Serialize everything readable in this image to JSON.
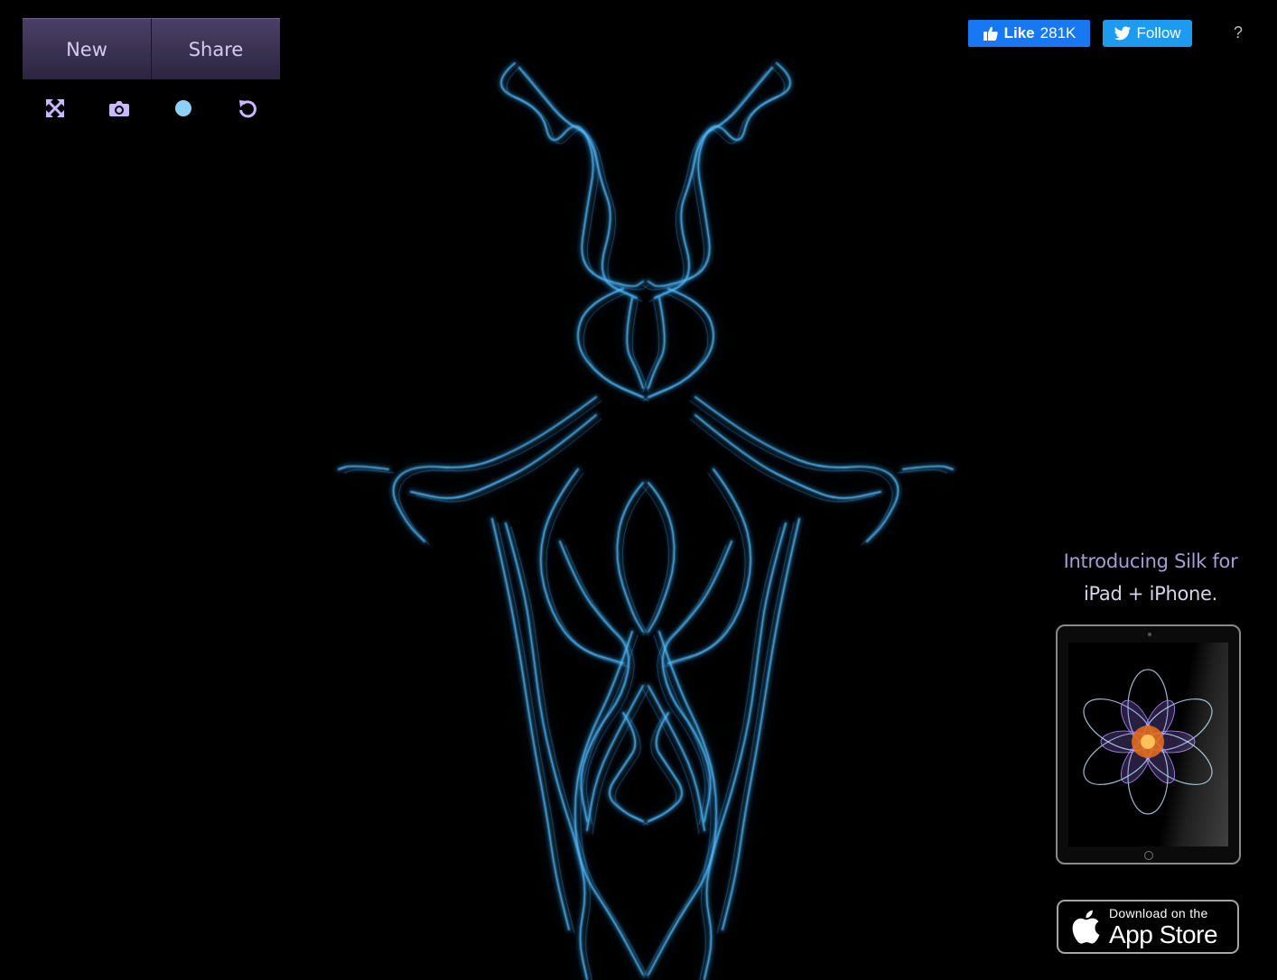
{
  "toolbar": {
    "new_label": "New",
    "share_label": "Share",
    "tools": [
      "fullscreen-icon",
      "camera-icon",
      "color-dot-icon",
      "undo-icon"
    ]
  },
  "social": {
    "like_label": "Like",
    "like_count": "281K",
    "follow_label": "Follow",
    "help_label": "?"
  },
  "promo": {
    "line1": "Introducing Silk for",
    "line2": "iPad + iPhone.",
    "store_small": "Download on the",
    "store_big": "App Store"
  },
  "colors": {
    "silk": "#5fc4ff",
    "panel_top": "#4a4066",
    "panel_bottom": "#2c2540",
    "tool_icon": "#c9b8ff",
    "color_dot": "#8fd0f6",
    "facebook": "#1877f2",
    "twitter": "#1d9bf0",
    "promo_accent": "#a99bd6"
  }
}
